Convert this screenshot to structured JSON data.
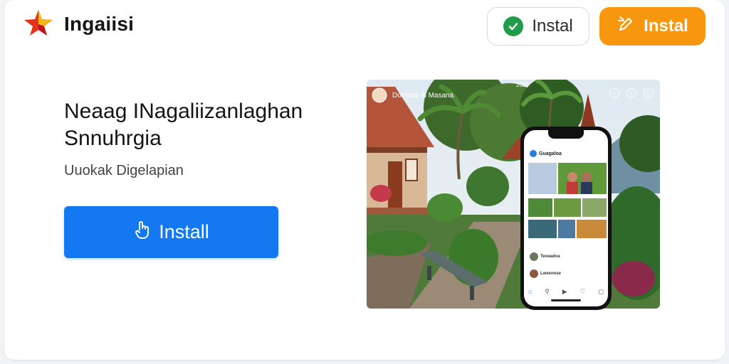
{
  "header": {
    "brand": "Ingaiisi",
    "secondary_button_label": "Instal",
    "primary_button_label": "Instal"
  },
  "main": {
    "title_line1": "Neaag INagaliizanlaghan",
    "title_line2": "Snnuhrgia",
    "subtitle": "Uuokak Digelapian",
    "install_label": "Install"
  },
  "hero": {
    "photo_caption": "Domaos §i Masana",
    "photo_number": "2021",
    "phone_header": "Guagaloa",
    "phone_item1": "Teoeadoa",
    "phone_item2": "Lweenose"
  },
  "colors": {
    "primary_blue": "#1479f0",
    "orange": "#f7960f",
    "check_green": "#1f9d4c"
  },
  "icons": {
    "logo": "star-flame-logo",
    "secondary_button": "check-circle-icon",
    "primary_button": "edit-icon",
    "install_button": "hand-tap-icon"
  }
}
